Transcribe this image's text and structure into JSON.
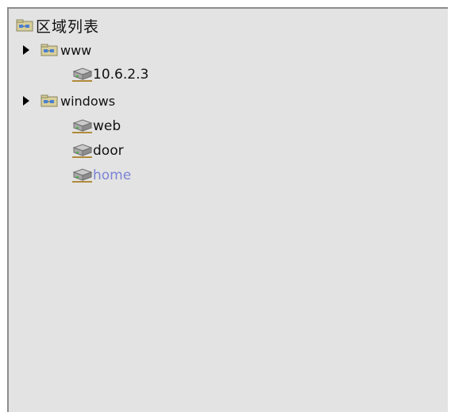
{
  "tree": {
    "root": {
      "label": "区域列表",
      "icon": "folder-network-icon"
    },
    "groups": [
      {
        "label": "www",
        "icon": "folder-network-icon",
        "expander": "expand-arrow-icon",
        "children": [
          {
            "label": "10.6.2.3",
            "icon": "server-icon",
            "selected": false
          }
        ]
      },
      {
        "label": "windows",
        "icon": "folder-network-icon",
        "expander": "expand-arrow-icon",
        "children": [
          {
            "label": "web",
            "icon": "server-icon",
            "selected": false
          },
          {
            "label": "door",
            "icon": "server-icon",
            "selected": false
          },
          {
            "label": "home",
            "icon": "server-icon",
            "selected": true
          }
        ]
      }
    ]
  },
  "colors": {
    "panel_bg": "#e3e3e3",
    "border": "#8c8c8c",
    "text": "#111111",
    "selected_text": "#7b84d6"
  }
}
